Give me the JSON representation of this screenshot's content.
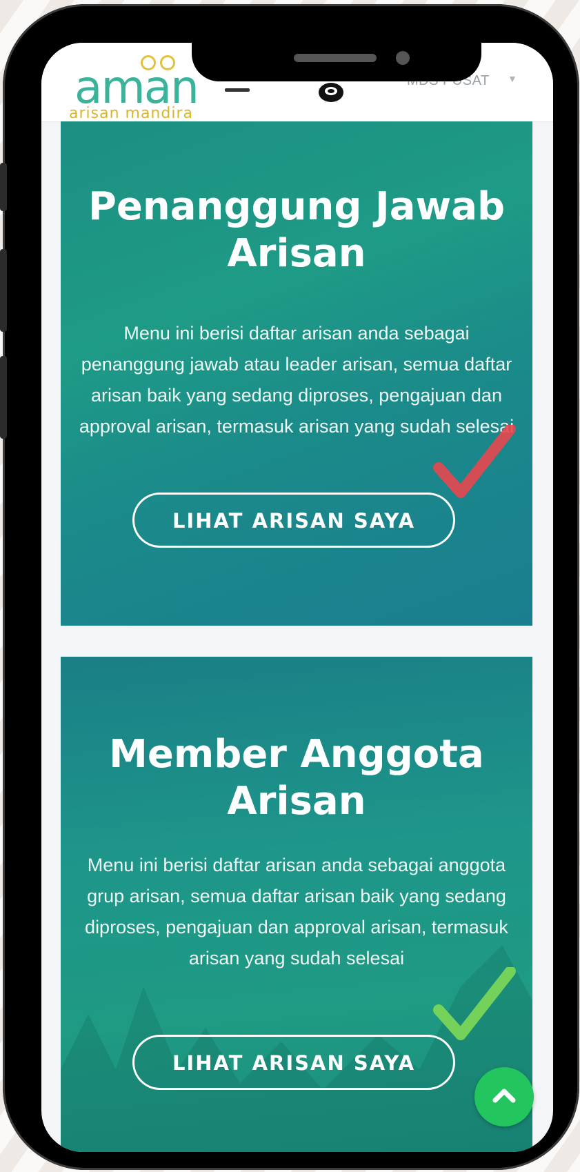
{
  "header": {
    "logo_text": "aman",
    "logo_subtitle": "arisan mandira",
    "user_label": "MDS PUSAT"
  },
  "cards": [
    {
      "title": "Penanggung Jawab Arisan",
      "description": "Menu ini berisi daftar arisan anda sebagai penanggung jawab atau leader arisan, semua daftar arisan baik yang sedang diproses, pengajuan dan approval arisan, termasuk arisan yang sudah selesai",
      "button_label": "LIHAT ARISAN SAYA",
      "check_color": "#e8474e"
    },
    {
      "title": "Member Anggota Arisan",
      "description": "Menu ini berisi daftar arisan anda sebagai anggota grup arisan, semua daftar arisan baik yang sedang diproses, pengajuan dan approval arisan, termasuk arisan yang sudah selesai",
      "button_label": "LIHAT ARISAN SAYA",
      "check_color": "#7ed957"
    }
  ],
  "icons": {
    "menu": "hamburger-icon",
    "user": "user-avatar-icon",
    "caret": "caret-down-icon",
    "scroll_top": "chevron-up-icon"
  },
  "colors": {
    "brand_green": "#3bb39a",
    "brand_gold": "#d8b52c",
    "card_teal": "#1c8f82",
    "scroll_button": "#22c55e"
  }
}
